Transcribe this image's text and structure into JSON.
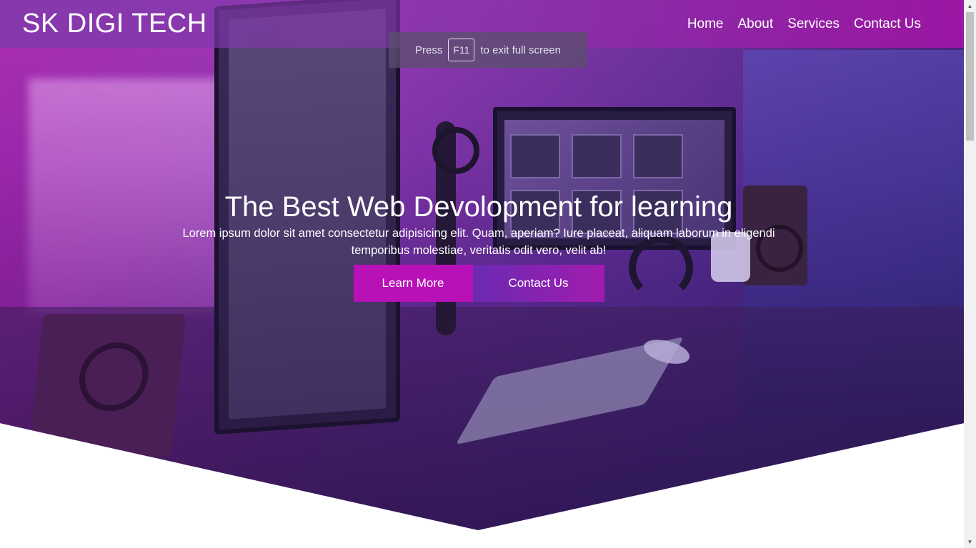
{
  "navbar": {
    "brand": "SK DIGI TECH",
    "links": [
      "Home",
      "About",
      "Services",
      "Contact Us"
    ]
  },
  "fullscreen_hint": {
    "before": "Press",
    "key": "F11",
    "after": "to exit full screen"
  },
  "hero": {
    "title": "The Best Web Devolopment for learning",
    "text": "Lorem ipsum dolor sit amet consectetur adipisicing elit. Quam, aperiam? Iure placeat, aliquam laborum in eligendi temporibus molestiae, veritatis odit vero, velit ab!",
    "learn_more": "Learn More",
    "contact_us": "Contact Us"
  },
  "colors": {
    "accent": "#b811b8",
    "nav_gradient_end": "#aa14aa",
    "hero_dark": "#2e1b5c"
  },
  "icons": {
    "scroll_up": "triangle-up-icon",
    "scroll_down": "triangle-down-icon"
  }
}
